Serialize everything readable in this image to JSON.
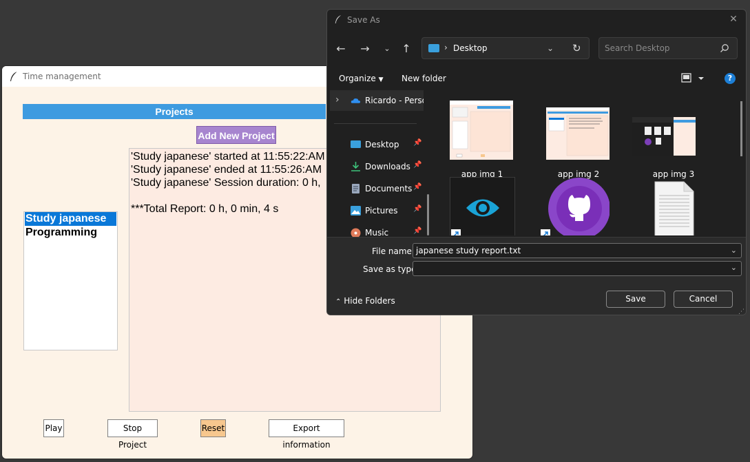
{
  "time_management": {
    "title": "Time management",
    "projects_header": "Projects",
    "add_button": "Add New Project",
    "projects": [
      "Study japanese",
      "Programming"
    ],
    "log_lines": [
      "'Study japanese' started at 11:55:22:AM",
      "'Study japanese' ended at 11:55:26:AM",
      "'Study japanese' Session duration: 0 h,",
      "",
      "***Total Report: 0 h, 0 min, 4 s"
    ],
    "buttons": {
      "play": "Play",
      "stop": "Stop Project",
      "reset": "Reset",
      "export": "Export information"
    }
  },
  "save_dialog": {
    "title": "Save As",
    "address": "Desktop",
    "search_placeholder": "Search Desktop",
    "toolbar": {
      "organize": "Organize",
      "new_folder": "New folder"
    },
    "sidebar": [
      {
        "label": "Ricardo - Personal",
        "icon": "onedrive-cloud-icon"
      },
      {
        "label": "Desktop",
        "icon": "desktop-icon",
        "pinned": true
      },
      {
        "label": "Downloads",
        "icon": "download-icon",
        "pinned": true
      },
      {
        "label": "Documents",
        "icon": "document-icon",
        "pinned": true
      },
      {
        "label": "Pictures",
        "icon": "picture-icon",
        "pinned": true
      },
      {
        "label": "Music",
        "icon": "music-icon",
        "pinned": true
      }
    ],
    "files": [
      {
        "name": "app img 1",
        "icon": "image-thumbnail"
      },
      {
        "name": "app img 2",
        "icon": "image-thumbnail"
      },
      {
        "name": "app img 3",
        "icon": "image-thumbnail"
      },
      {
        "name": "",
        "icon": "eye-app-shortcut-icon"
      },
      {
        "name": "",
        "icon": "github-shortcut-icon"
      },
      {
        "name": "",
        "icon": "text-file-icon"
      }
    ],
    "file_name_label": "File name:",
    "file_name_value": "japanese study report.txt",
    "save_type_label": "Save as type:",
    "save_type_value": "",
    "hide_folders": "Hide Folders",
    "save_button": "Save",
    "cancel_button": "Cancel",
    "accent_color": "#1d7fd6"
  }
}
